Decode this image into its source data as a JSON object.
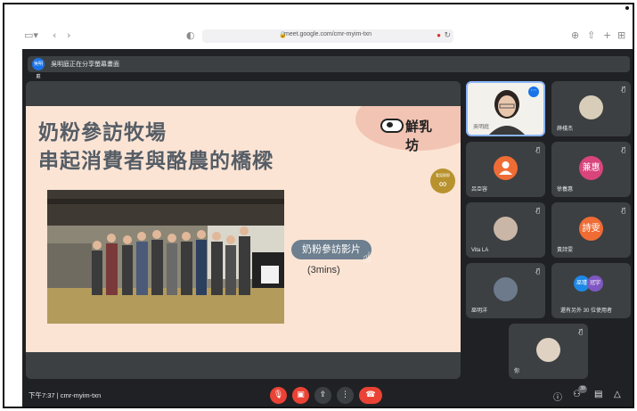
{
  "browser": {
    "url": "meet.google.com/cmr-myim-txn",
    "icons": [
      "sidebar-icon",
      "back-icon",
      "forward-icon",
      "shield-icon",
      "lock-icon",
      "mic-icon",
      "reload-icon",
      "download-icon",
      "share-icon",
      "new-tab-icon",
      "tabs-grid-icon"
    ]
  },
  "meet": {
    "banner": {
      "avatar": "吳明庭",
      "text": "吳明庭正在分享螢幕畫面"
    },
    "slide": {
      "title_line1": "奶粉參訪牧場",
      "title_line2": "串起消費者與酪農的橋樑",
      "brand": "鮮乳坊",
      "badge_top": "看見即即",
      "badge_symbol": "∞",
      "video_button": "奶粉參訪影片",
      "video_duration": "(3mins)"
    },
    "tiles": [
      {
        "name": "吳明庭",
        "type": "video-active"
      },
      {
        "name": "薛棧杰",
        "type": "photo"
      },
      {
        "name": "呂亞容",
        "initial": "",
        "color": "#ef6c35"
      },
      {
        "name": "徐養惠",
        "initial": "兼惠",
        "color": "#d9457b"
      },
      {
        "name": "Vita LA",
        "type": "photo"
      },
      {
        "name": "黃詩雯",
        "initial": "詩雯",
        "color": "#ef6c35"
      },
      {
        "name": "巫明洋",
        "type": "photo"
      },
      {
        "name": "還有另外 30 位使用者",
        "avatars": [
          "巫瑾",
          "冠宇"
        ]
      },
      {
        "name": "你",
        "type": "photo"
      }
    ],
    "bottom": {
      "meeting_info": "下午7:37  |  cmr-myim-txn",
      "participant_count": "39"
    }
  }
}
